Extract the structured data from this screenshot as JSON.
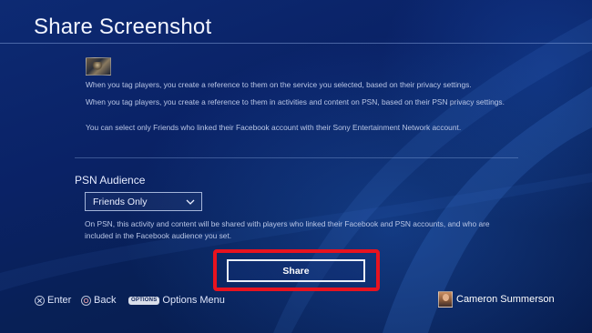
{
  "screen": {
    "title": "Share Screenshot"
  },
  "info": {
    "line1": "When you tag players, you create a reference to them on the service you selected, based on their privacy settings.",
    "line2": "When you tag players, you create a reference to them in activities and content on PSN, based on their PSN privacy settings.",
    "line3": "You can select only Friends who linked their Facebook account with their Sony Entertainment Network account."
  },
  "audience": {
    "label": "PSN Audience",
    "selected": "Friends Only",
    "description": "On PSN, this activity and content will be shared with players who linked their Facebook and PSN accounts, and who are included in the Facebook audience you set."
  },
  "actions": {
    "share_label": "Share"
  },
  "footer": {
    "enter_label": "Enter",
    "back_label": "Back",
    "options_pill": "OPTIONS",
    "options_label": "Options Menu",
    "user_name": "Cameron Summerson"
  },
  "colors": {
    "highlight": "#e8131f",
    "background": "#0a2266"
  },
  "icons": {
    "enter": "cross-button-icon",
    "back": "circle-button-icon",
    "dropdown": "chevron-down-icon"
  }
}
